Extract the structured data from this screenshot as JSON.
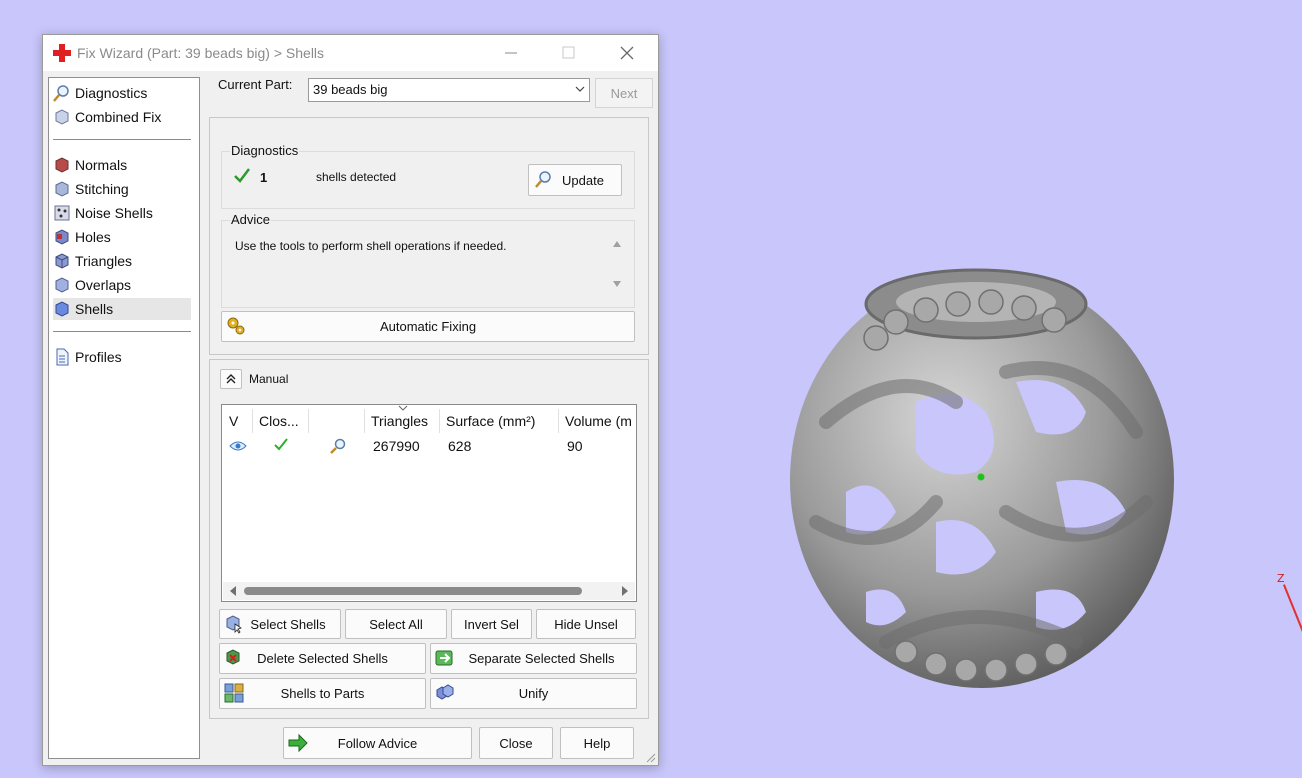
{
  "window": {
    "title": "Fix Wizard (Part: 39 beads big) > Shells"
  },
  "nav": {
    "items": [
      {
        "label": "Diagnostics",
        "icon": "magnifier-icon"
      },
      {
        "label": "Combined Fix",
        "icon": "cube-icon"
      },
      {
        "label": "Normals",
        "icon": "normals-cube-icon"
      },
      {
        "label": "Stitching",
        "icon": "stitching-cube-icon"
      },
      {
        "label": "Noise Shells",
        "icon": "noise-shells-icon"
      },
      {
        "label": "Holes",
        "icon": "holes-cube-icon"
      },
      {
        "label": "Triangles",
        "icon": "triangles-cube-icon"
      },
      {
        "label": "Overlaps",
        "icon": "overlaps-cube-icon"
      },
      {
        "label": "Shells",
        "icon": "shells-cube-icon",
        "selected": true
      },
      {
        "label": "Profiles",
        "icon": "document-icon"
      }
    ]
  },
  "part": {
    "label": "Current Part:",
    "value": "39 beads big",
    "next_label": "Next"
  },
  "diagnostics": {
    "title": "Diagnostics",
    "count": "1",
    "message": "shells detected",
    "update_label": "Update"
  },
  "advice": {
    "title": "Advice",
    "text": "Use the tools to perform shell operations if needed."
  },
  "automatic_fixing_label": "Automatic Fixing",
  "manual": {
    "title": "Manual",
    "columns": [
      "V",
      "Clos...",
      "",
      "Triangles",
      "Surface (mm²)",
      "Volume (m"
    ],
    "rows": [
      {
        "triangles": "267990",
        "surface": "628",
        "volume": "90"
      }
    ]
  },
  "buttons": {
    "select_shells": "Select Shells",
    "select_all": "Select All",
    "invert_sel": "Invert Sel",
    "hide_unsel": "Hide Unsel",
    "delete_selected": "Delete Selected Shells",
    "separate_selected": "Separate Selected Shells",
    "shells_to_parts": "Shells to Parts",
    "unify": "Unify",
    "follow_advice": "Follow Advice",
    "close": "Close",
    "help": "Help"
  },
  "viewport": {
    "axis_label": "Z",
    "background": "#c8c6fa"
  },
  "colors": {
    "accent_green": "#2a9a2a",
    "title_icon_red": "#e02020"
  }
}
